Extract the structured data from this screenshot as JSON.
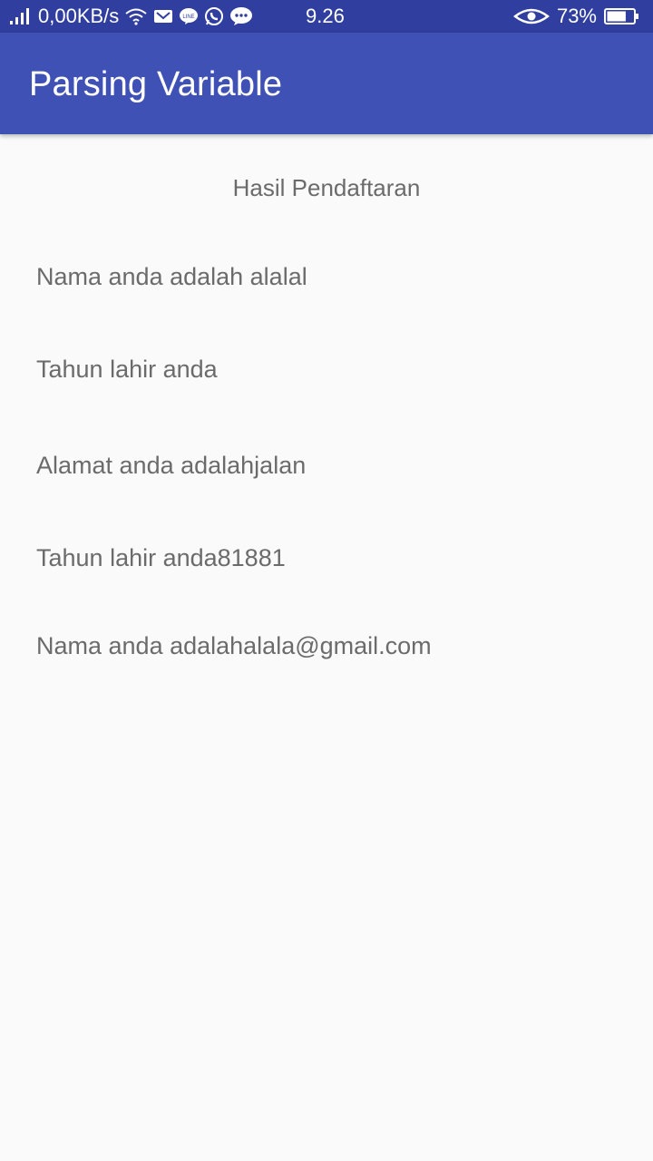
{
  "status_bar": {
    "network_speed": "0,00KB/s",
    "time": "9.26",
    "battery_percent": "73%",
    "battery_level": 0.73,
    "icons": [
      "signal-icon",
      "wifi-icon",
      "gmail-icon",
      "line-icon",
      "whatsapp-icon",
      "chat-icon",
      "eye-icon",
      "battery-icon"
    ]
  },
  "app_bar": {
    "title": "Parsing Variable",
    "color": "#3f51b5",
    "status_color": "#303f9f"
  },
  "main": {
    "heading": "Hasil Pendaftaran",
    "lines": [
      "Nama anda adalah alalal",
      "Tahun lahir anda",
      "Alamat anda adalahjalan",
      "Tahun lahir anda81881",
      "Nama anda adalahalala@gmail.com"
    ]
  }
}
